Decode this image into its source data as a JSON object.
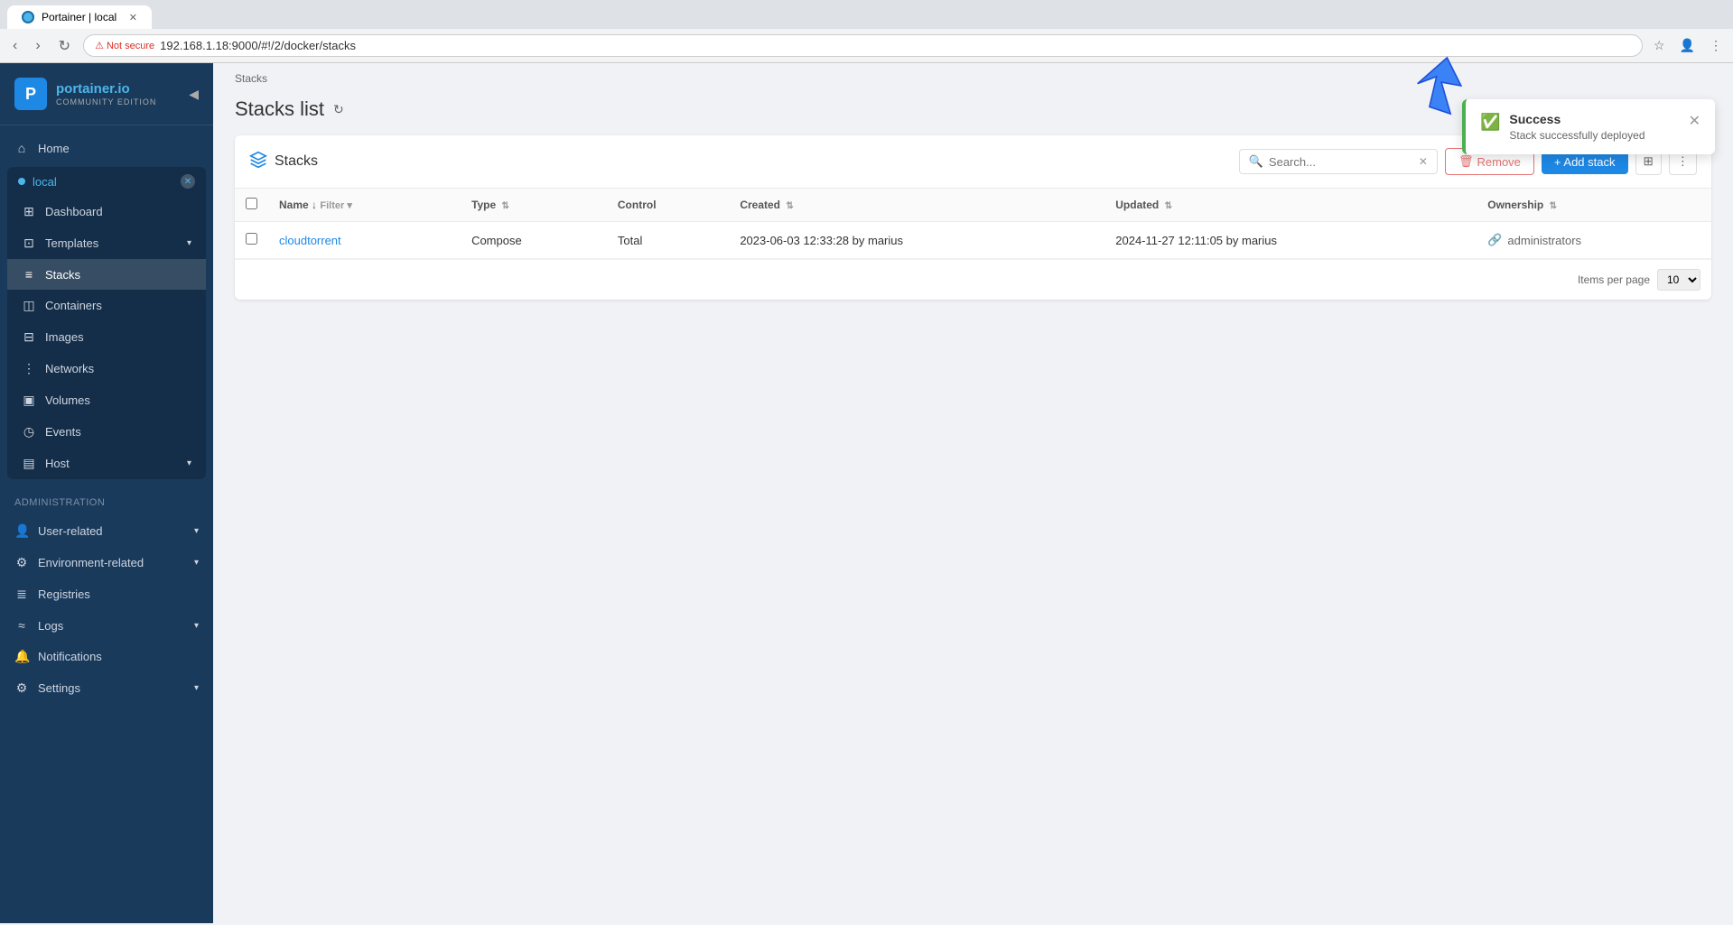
{
  "browser": {
    "tab_title": "Portainer | local",
    "url": "192.168.1.18:9000/#!/2/docker/stacks",
    "not_secure_label": "Not secure"
  },
  "sidebar": {
    "logo_name": "portainer.io",
    "logo_sub": "COMMUNITY EDITION",
    "collapse_icon": "◀",
    "env_name": "local",
    "env_close": "✕",
    "nav_items": [
      {
        "id": "home",
        "label": "Home",
        "icon": "⌂"
      },
      {
        "id": "dashboard",
        "label": "Dashboard",
        "icon": "⊞"
      },
      {
        "id": "templates",
        "label": "Templates",
        "icon": "⊡",
        "has_arrow": true
      },
      {
        "id": "stacks",
        "label": "Stacks",
        "icon": "≡",
        "active": true
      },
      {
        "id": "containers",
        "label": "Containers",
        "icon": "◫"
      },
      {
        "id": "images",
        "label": "Images",
        "icon": "⊟"
      },
      {
        "id": "networks",
        "label": "Networks",
        "icon": "⋮"
      },
      {
        "id": "volumes",
        "label": "Volumes",
        "icon": "▣"
      },
      {
        "id": "events",
        "label": "Events",
        "icon": "◷"
      },
      {
        "id": "host",
        "label": "Host",
        "icon": "▤",
        "has_arrow": true
      }
    ],
    "admin_label": "Administration",
    "admin_items": [
      {
        "id": "user-related",
        "label": "User-related",
        "icon": "👤",
        "has_arrow": true
      },
      {
        "id": "environment-related",
        "label": "Environment-related",
        "icon": "⚙",
        "has_arrow": true
      },
      {
        "id": "registries",
        "label": "Registries",
        "icon": "≣"
      },
      {
        "id": "logs",
        "label": "Logs",
        "icon": "≈",
        "has_arrow": true
      },
      {
        "id": "notifications",
        "label": "Notifications",
        "icon": "🔔"
      },
      {
        "id": "settings",
        "label": "Settings",
        "icon": "⚙",
        "has_arrow": true
      }
    ]
  },
  "breadcrumb": "Stacks",
  "page_title": "Stacks list",
  "card": {
    "title": "Stacks",
    "search_placeholder": "Search...",
    "remove_label": "Remove",
    "add_label": "+ Add stack",
    "columns": [
      {
        "id": "name",
        "label": "Name ↓",
        "has_filter": true
      },
      {
        "id": "type",
        "label": "Type"
      },
      {
        "id": "control",
        "label": "Control"
      },
      {
        "id": "created",
        "label": "Created"
      },
      {
        "id": "updated",
        "label": "Updated"
      },
      {
        "id": "ownership",
        "label": "Ownership"
      }
    ],
    "rows": [
      {
        "name": "cloudtorrent",
        "type": "Compose",
        "control": "Total",
        "created": "2023-06-03 12:33:28 by marius",
        "updated": "2024-11-27 12:11:05 by marius",
        "ownership": "administrators"
      }
    ],
    "items_per_page_label": "Items per page",
    "items_per_page_value": "10"
  },
  "toast": {
    "title": "Success",
    "message": "Stack successfully deployed",
    "close": "✕"
  }
}
